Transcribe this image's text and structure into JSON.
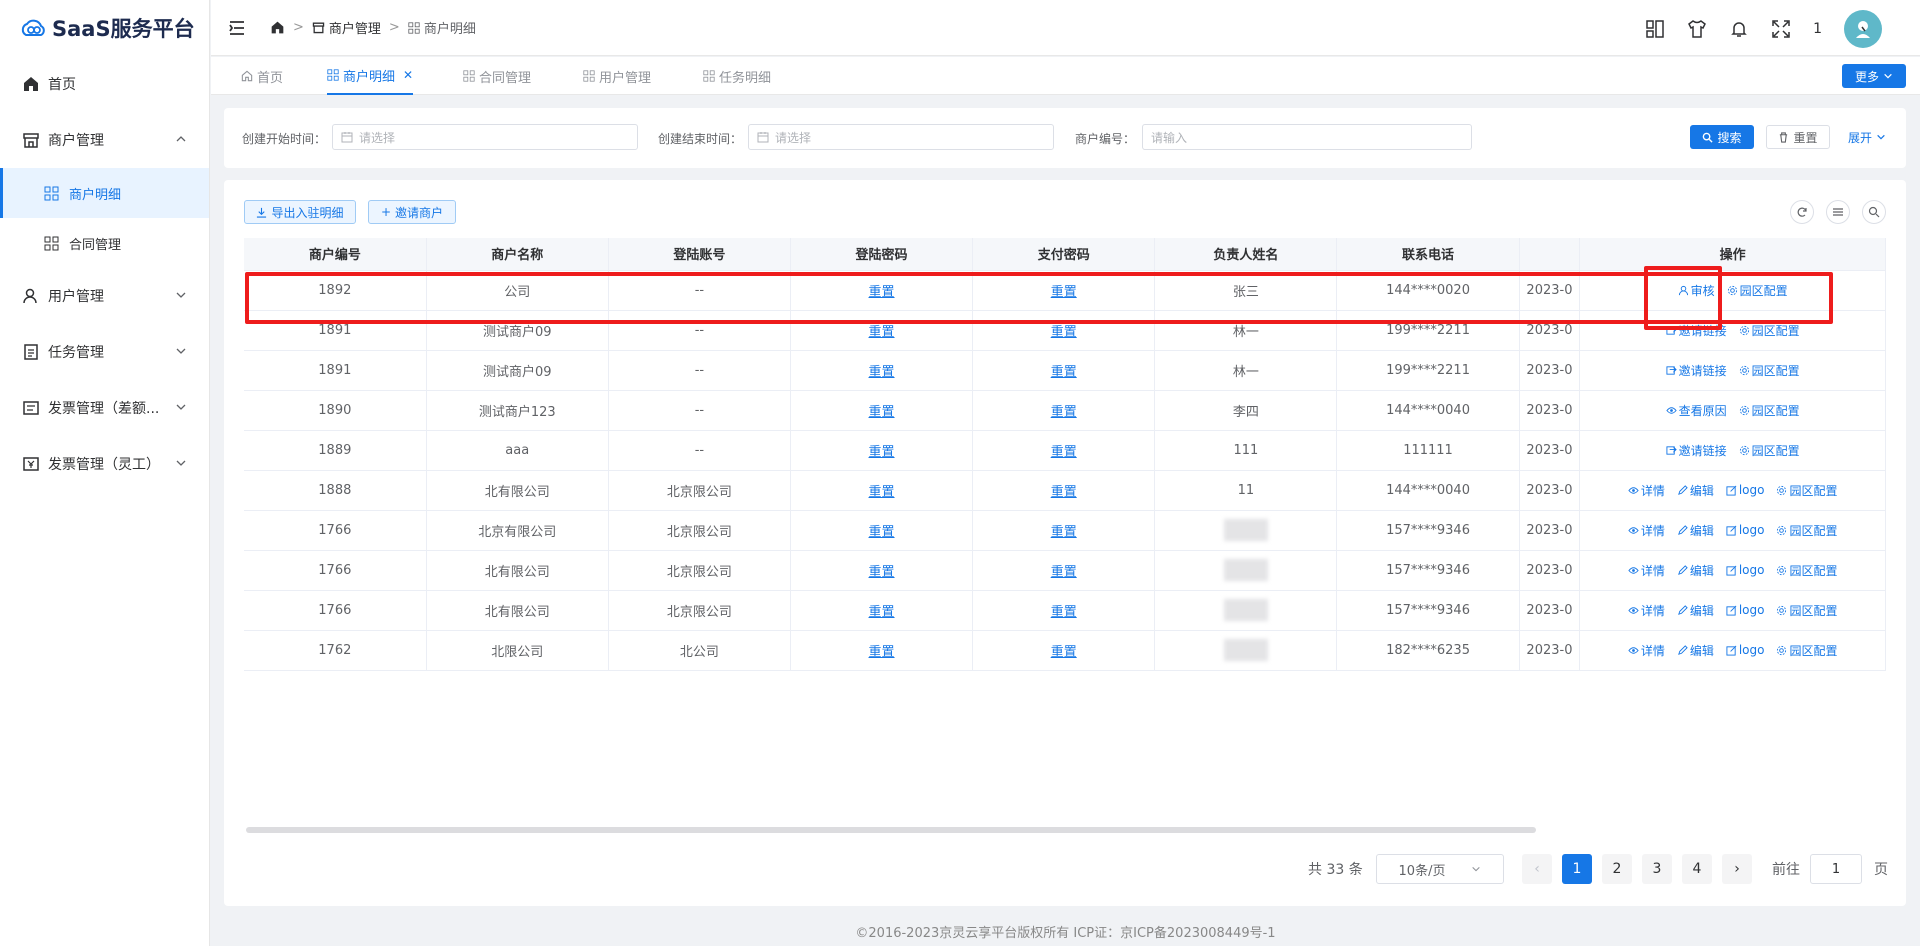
{
  "app": {
    "title": "SaaS服务平台",
    "colors": {
      "primary": "#1677e6",
      "annotation": "#ee1c1c"
    }
  },
  "sidebar": {
    "items": [
      {
        "label": "首页",
        "icon": "home-icon"
      },
      {
        "label": "商户管理",
        "icon": "store-icon",
        "expanded": true,
        "children": [
          {
            "label": "商户明细",
            "active": true
          },
          {
            "label": "合同管理"
          }
        ]
      },
      {
        "label": "用户管理",
        "icon": "user-icon"
      },
      {
        "label": "任务管理",
        "icon": "clipboard-icon"
      },
      {
        "label": "发票管理（差额...",
        "icon": "invoice-icon"
      },
      {
        "label": "发票管理（灵工）",
        "icon": "yen-invoice-icon"
      }
    ]
  },
  "header": {
    "breadcrumb": [
      "商户管理",
      "商户明细"
    ],
    "notification_count": "1"
  },
  "tabs": [
    {
      "label": "首页"
    },
    {
      "label": "商户明细",
      "active": true
    },
    {
      "label": "合同管理"
    },
    {
      "label": "用户管理"
    },
    {
      "label": "任务明细"
    }
  ],
  "tabs_more": "更多",
  "search": {
    "start_label": "创建开始时间：",
    "start_placeholder": "请选择",
    "end_label": "创建结束时间：",
    "end_placeholder": "请选择",
    "merchant_no_label": "商户编号：",
    "merchant_no_placeholder": "请输入",
    "search_btn": "搜索",
    "reset_btn": "重置",
    "expand_btn": "展开"
  },
  "toolbar": {
    "export_btn": "导出入驻明细",
    "invite_btn": "邀请商户"
  },
  "table": {
    "headers": [
      "商户编号",
      "商户名称",
      "登陆账号",
      "登陆密码",
      "支付密码",
      "负责人姓名",
      "联系电话",
      "",
      "操作"
    ],
    "rows": [
      {
        "id": "1892",
        "name": "公司",
        "account": "--",
        "login_pwd": "重置",
        "pay_pwd": "重置",
        "owner": "张三",
        "phone": "144****0020",
        "date": "2023-0",
        "ops": [
          "审核",
          "园区配置"
        ]
      },
      {
        "id": "1891",
        "name": "测试商户09",
        "account": "--",
        "login_pwd": "重置",
        "pay_pwd": "重置",
        "owner": "林一",
        "phone": "199****2211",
        "date": "2023-0",
        "ops": [
          "邀请链接",
          "园区配置"
        ]
      },
      {
        "id": "1891",
        "name": "测试商户09",
        "account": "--",
        "login_pwd": "重置",
        "pay_pwd": "重置",
        "owner": "林一",
        "phone": "199****2211",
        "date": "2023-0",
        "ops": [
          "邀请链接",
          "园区配置"
        ]
      },
      {
        "id": "1890",
        "name": "测试商户123",
        "account": "--",
        "login_pwd": "重置",
        "pay_pwd": "重置",
        "owner": "李四",
        "phone": "144****0040",
        "date": "2023-0",
        "ops": [
          "查看原因",
          "园区配置"
        ]
      },
      {
        "id": "1889",
        "name": "aaa",
        "account": "--",
        "login_pwd": "重置",
        "pay_pwd": "重置",
        "owner": "111",
        "phone": "111111",
        "date": "2023-0",
        "ops": [
          "邀请链接",
          "园区配置"
        ]
      },
      {
        "id": "1888",
        "name": "北有限公司",
        "account": "北京限公司",
        "login_pwd": "重置",
        "pay_pwd": "重置",
        "owner": "11",
        "phone": "144****0040",
        "date": "2023-0",
        "ops": [
          "详情",
          "编辑",
          "logo",
          "园区配置"
        ]
      },
      {
        "id": "1766",
        "name": "北京有限公司",
        "account": "北京限公司",
        "login_pwd": "重置",
        "pay_pwd": "重置",
        "owner": "",
        "phone": "157****9346",
        "date": "2023-0",
        "ops": [
          "详情",
          "编辑",
          "logo",
          "园区配置"
        ]
      },
      {
        "id": "1766",
        "name": "北有限公司",
        "account": "北京限公司",
        "login_pwd": "重置",
        "pay_pwd": "重置",
        "owner": "",
        "phone": "157****9346",
        "date": "2023-0",
        "ops": [
          "详情",
          "编辑",
          "logo",
          "园区配置"
        ]
      },
      {
        "id": "1766",
        "name": "北有限公司",
        "account": "北京限公司",
        "login_pwd": "重置",
        "pay_pwd": "重置",
        "owner": "",
        "phone": "157****9346",
        "date": "2023-0",
        "ops": [
          "详情",
          "编辑",
          "logo",
          "园区配置"
        ]
      },
      {
        "id": "1762",
        "name": "北限公司",
        "account": "北公司",
        "login_pwd": "重置",
        "pay_pwd": "重置",
        "owner": "",
        "phone": "182****6235",
        "date": "2023-0",
        "ops": [
          "详情",
          "编辑",
          "logo",
          "园区配置"
        ]
      }
    ]
  },
  "pagination": {
    "total": "共 33 条",
    "page_size": "10条/页",
    "pages": [
      "1",
      "2",
      "3",
      "4"
    ],
    "current": "1",
    "goto_label": "前往",
    "goto_value": "1",
    "page_suffix": "页"
  },
  "footer": "©2016-2023京灵云享平台版权所有 ICP证：京ICP备2023008449号-1"
}
